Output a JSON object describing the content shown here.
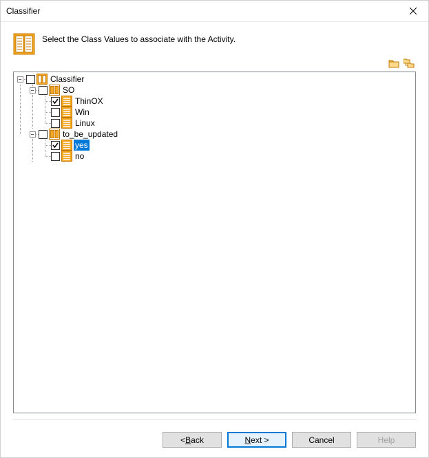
{
  "window": {
    "title": "Classifier"
  },
  "intro": {
    "text": "Select the Class Values to associate with the Activity."
  },
  "tree": {
    "root": {
      "label": "Classifier",
      "checked": false,
      "expanded": true,
      "children": [
        {
          "label": "SO",
          "checked": false,
          "expanded": true,
          "children": [
            {
              "label": "ThinOX",
              "checked": true
            },
            {
              "label": "Win",
              "checked": false
            },
            {
              "label": "Linux",
              "checked": false
            }
          ]
        },
        {
          "label": "to_be_updated",
          "checked": false,
          "expanded": true,
          "children": [
            {
              "label": "yes",
              "checked": true,
              "selected": true
            },
            {
              "label": "no",
              "checked": false
            }
          ]
        }
      ]
    }
  },
  "buttons": {
    "back": "< Back",
    "next": "Next >",
    "cancel": "Cancel",
    "help": "Help"
  }
}
